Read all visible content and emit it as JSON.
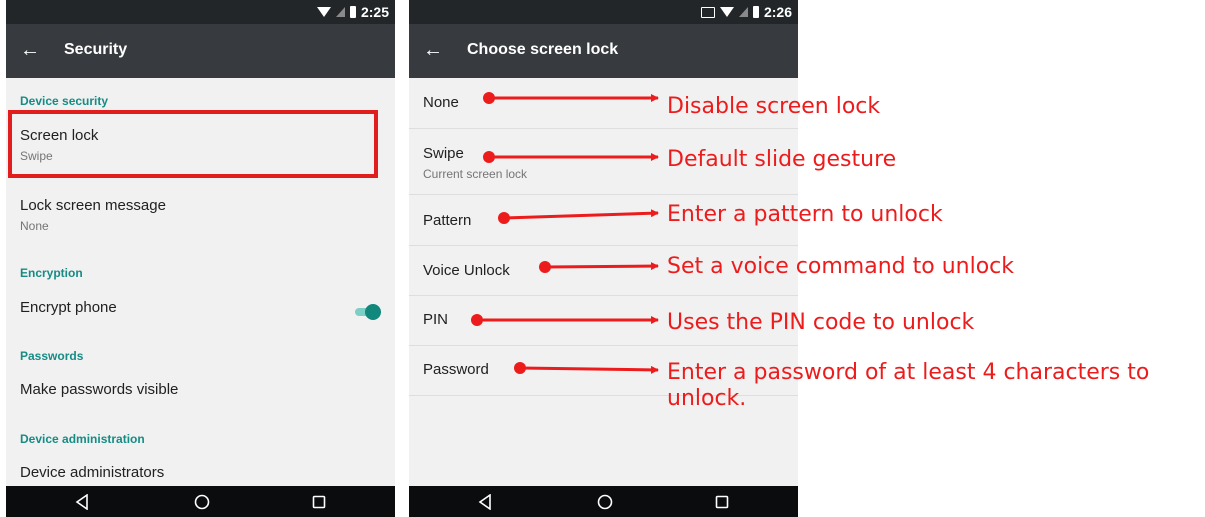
{
  "left_screen": {
    "status_time": "2:25",
    "title": "Security",
    "sections": {
      "device_security": "Device security",
      "encryption": "Encryption",
      "passwords": "Passwords",
      "device_administration": "Device administration"
    },
    "items": {
      "screen_lock": {
        "title": "Screen lock",
        "summary": "Swipe"
      },
      "lock_screen_message": {
        "title": "Lock screen message",
        "summary": "None"
      },
      "encrypt_phone": {
        "title": "Encrypt phone"
      },
      "make_passwords_visible": {
        "title": "Make passwords visible",
        "enabled": true
      },
      "device_administrators": {
        "title": "Device administrators"
      }
    }
  },
  "right_screen": {
    "status_time": "2:26",
    "title": "Choose screen lock",
    "options": [
      {
        "title": "None",
        "summary": ""
      },
      {
        "title": "Swipe",
        "summary": "Current screen lock"
      },
      {
        "title": "Pattern",
        "summary": ""
      },
      {
        "title": "Voice Unlock",
        "summary": ""
      },
      {
        "title": "PIN",
        "summary": ""
      },
      {
        "title": "Password",
        "summary": ""
      }
    ]
  },
  "annotations": [
    "Disable screen lock",
    "Default slide gesture",
    "Enter a pattern to unlock",
    "Set a voice command to unlock",
    "Uses the PIN code to unlock",
    "Enter a password of at least 4 characters to",
    "unlock."
  ],
  "colors": {
    "accent": "#168c84",
    "annotation": "#ed1c1c",
    "appbar": "#373b3f",
    "statusbar": "#222629",
    "navbar": "#0b0c0d"
  },
  "icons": {
    "status": [
      "wifi-icon",
      "no-sim-icon",
      "battery-icon",
      "cast-icon"
    ],
    "nav": [
      "nav-back-icon",
      "nav-home-icon",
      "nav-recents-icon"
    ],
    "app": [
      "back-arrow-icon"
    ]
  }
}
